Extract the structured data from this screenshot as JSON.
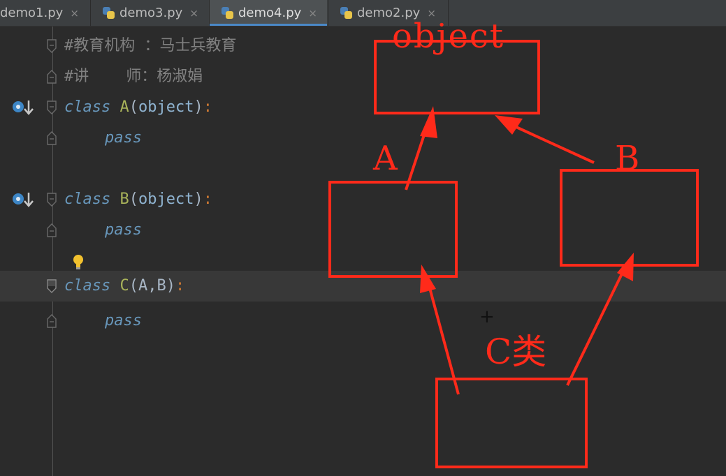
{
  "tabs": [
    {
      "label": "demo1.py",
      "close": "×"
    },
    {
      "label": "demo3.py",
      "close": "×"
    },
    {
      "label": "demo4.py",
      "close": "×"
    },
    {
      "label": "demo2.py",
      "close": "×"
    }
  ],
  "active_tab": "demo4.py",
  "code": {
    "comment1": "#教育机构 ：马士兵教育",
    "comment2": "#讲    师：杨淑娟",
    "kw_class": "class",
    "kw_pass": "pass",
    "class_a": "A",
    "class_b": "B",
    "class_c": "C",
    "base_a": "object",
    "base_b": "object",
    "base_c": "A,B"
  },
  "annotation": {
    "color": "#ff2a1a",
    "label_object": "object",
    "label_a": "A",
    "label_b": "B",
    "label_c": "C类",
    "cursor": "+"
  }
}
